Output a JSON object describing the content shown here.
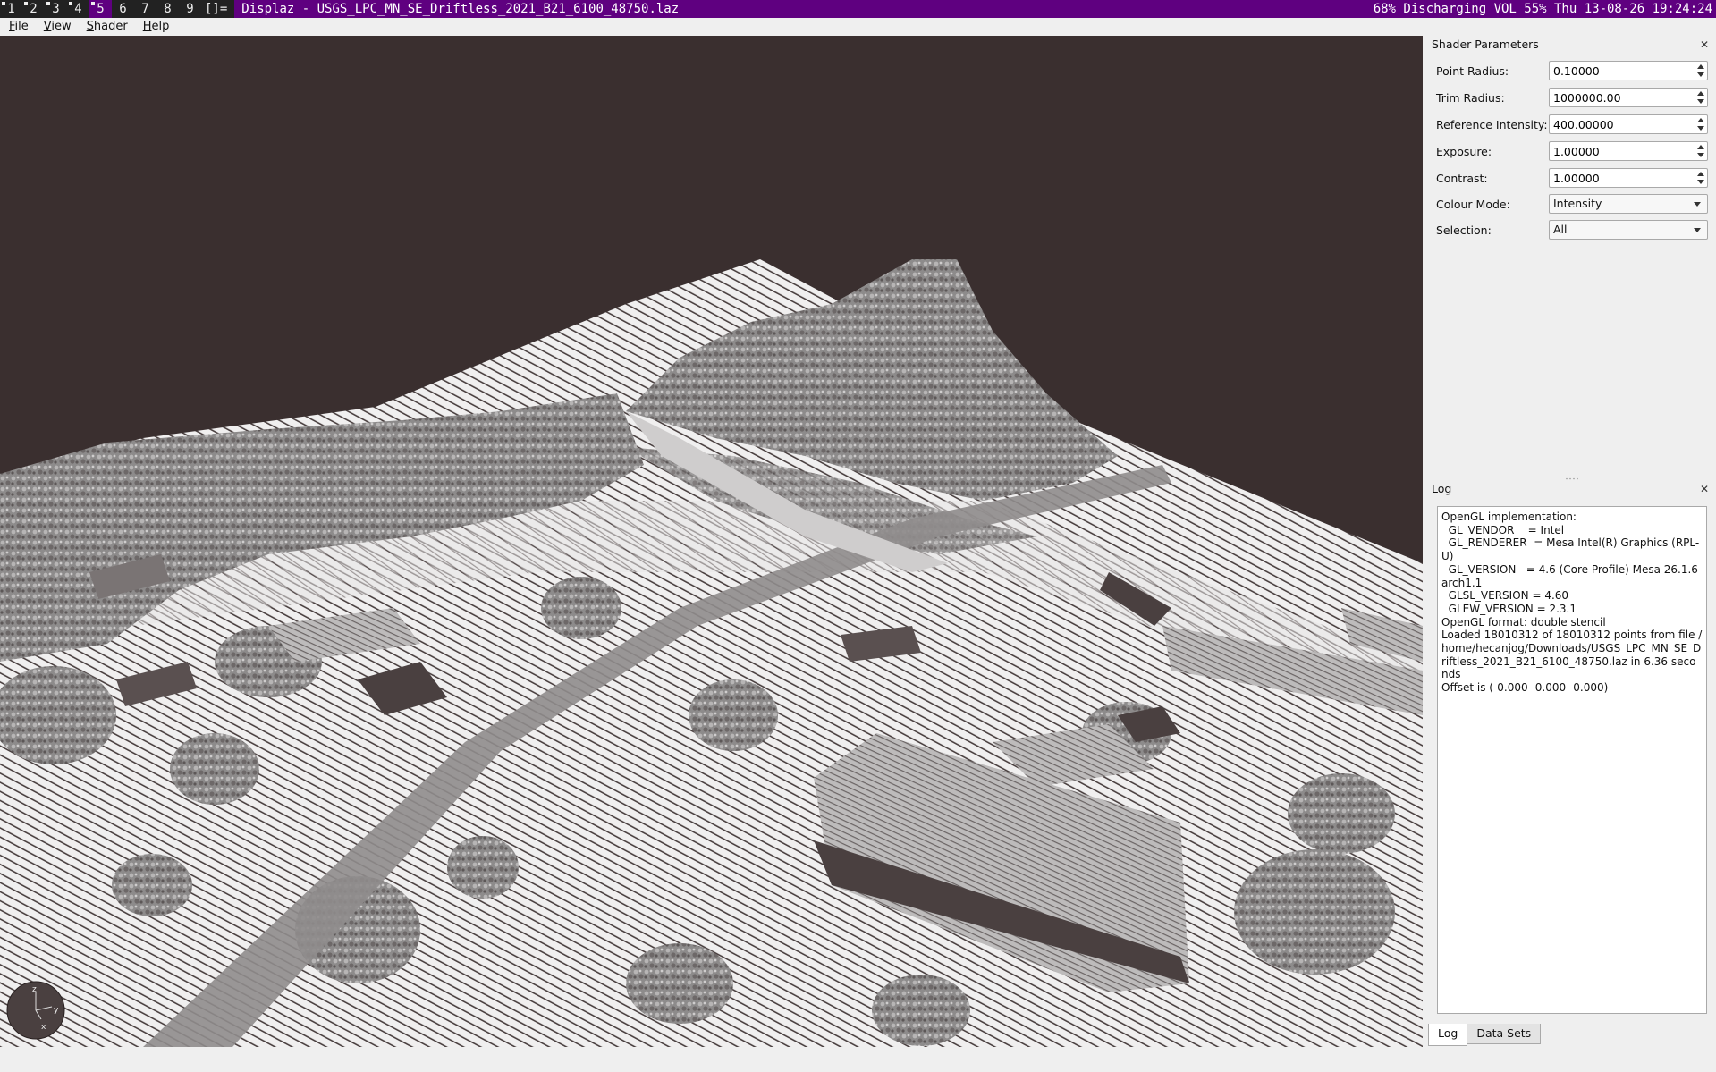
{
  "topbar": {
    "tags": [
      {
        "label": "1",
        "occupied": true,
        "active": false
      },
      {
        "label": "2",
        "occupied": true,
        "active": false
      },
      {
        "label": "3",
        "occupied": true,
        "active": false
      },
      {
        "label": "4",
        "occupied": true,
        "active": false
      },
      {
        "label": "5",
        "occupied": true,
        "active": true
      },
      {
        "label": "6",
        "occupied": false,
        "active": false
      },
      {
        "label": "7",
        "occupied": false,
        "active": false
      },
      {
        "label": "8",
        "occupied": false,
        "active": false
      },
      {
        "label": "9",
        "occupied": false,
        "active": false
      }
    ],
    "layout_symbol": "[]=",
    "window_title": "Displaz - USGS_LPC_MN_SE_Driftless_2021_B21_6100_48750.laz",
    "status": "68% Discharging VOL 55% Thu 13-08-26 19:24:24"
  },
  "menubar": {
    "file": "File",
    "view": "View",
    "shader": "Shader",
    "help": "Help"
  },
  "axes_gizmo": {
    "z": "z",
    "y": "y",
    "x": "x"
  },
  "shader_panel": {
    "title": "Shader Parameters",
    "params": {
      "point_radius": {
        "label": "Point Radius:",
        "value": "0.10000"
      },
      "trim_radius": {
        "label": "Trim Radius:",
        "value": "1000000.00"
      },
      "reference_intensity": {
        "label": "Reference Intensity:",
        "value": "400.00000"
      },
      "exposure": {
        "label": "Exposure:",
        "value": "1.00000"
      },
      "contrast": {
        "label": "Contrast:",
        "value": "1.00000"
      },
      "colour_mode": {
        "label": "Colour Mode:",
        "value": "Intensity"
      },
      "selection": {
        "label": "Selection:",
        "value": "All"
      }
    }
  },
  "log_panel": {
    "title": "Log",
    "text": "OpenGL implementation:\n  GL_VENDOR    = Intel\n  GL_RENDERER  = Mesa Intel(R) Graphics (RPL-U)\n  GL_VERSION   = 4.6 (Core Profile) Mesa 26.1.6-arch1.1\n  GLSL_VERSION = 4.60\n  GLEW_VERSION = 2.3.1\nOpenGL format: double stencil\nLoaded 18010312 of 18010312 points from file /home/hecanjog/Downloads/USGS_LPC_MN_SE_Driftless_2021_B21_6100_48750.laz in 6.36 seconds\nOffset is (-0.000 -0.000 -0.000)"
  },
  "tabs": {
    "log": "Log",
    "data_sets": "Data Sets"
  },
  "colors": {
    "accent": "#5f0080",
    "viewport_background": "#3a2f2f",
    "point_light": "#f2f2f2",
    "point_mid": "#9a9898",
    "point_dark": "#4a4040"
  }
}
